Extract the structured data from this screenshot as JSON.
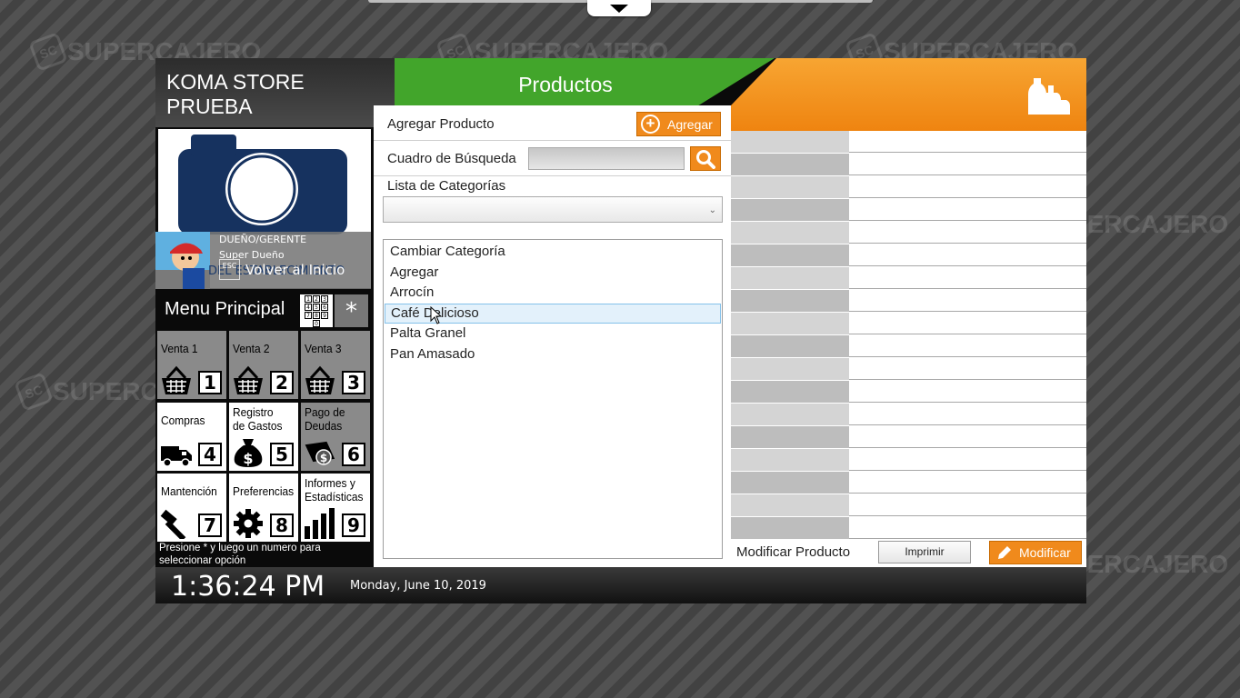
{
  "watermark": {
    "text": "SUPERCAJERO",
    "badge": "SC"
  },
  "store": {
    "line1": "KOMA STORE",
    "line2": "PRUEBA"
  },
  "user": {
    "role": "DUEÑO/GERENTE",
    "name": "Super Dueño",
    "establishment_text": "DEL ESTABLECIMIENTO",
    "esc_label": "ESC",
    "home_label": "Volver al Inicio"
  },
  "menu": {
    "title": "Menu Principal",
    "star_label": "*",
    "keypad_digits": [
      "1",
      "2",
      "3",
      "4",
      "5",
      "6",
      "7",
      "8",
      "9",
      "0"
    ],
    "tiles": [
      {
        "label": "Venta 1",
        "number": "1",
        "icon": "basket-icon"
      },
      {
        "label": "Venta 2",
        "number": "2",
        "icon": "basket-icon"
      },
      {
        "label": "Venta 3",
        "number": "3",
        "icon": "basket-icon"
      },
      {
        "label": "Compras",
        "number": "4",
        "icon": "truck-icon"
      },
      {
        "label": "Registro de Gastos",
        "line1": "Registro",
        "line2": "de Gastos",
        "number": "5",
        "icon": "money-bag-icon"
      },
      {
        "label": "Pago de Deudas",
        "line1": "Pago de",
        "line2": "Deudas",
        "number": "6",
        "icon": "bill-icon"
      },
      {
        "label": "Mantención",
        "number": "7",
        "icon": "hammer-icon"
      },
      {
        "label": "Preferencias",
        "number": "8",
        "icon": "gear-icon"
      },
      {
        "label": "Informes y Estadísticas",
        "line1": "Informes y",
        "line2": "Estadísticas",
        "number": "9",
        "icon": "bar-chart-icon"
      }
    ],
    "hint_line1": "Presione * y luego un numero para",
    "hint_line2": "seleccionar opción"
  },
  "footer": {
    "time": "1:36:24 PM",
    "date": "Monday, June 10, 2019"
  },
  "products": {
    "title": "Productos",
    "add_label": "Agregar Producto",
    "add_button": "Agregar",
    "search_label": "Cuadro de Búsqueda",
    "search_value": "",
    "category_label": "Lista de Categorías",
    "category_selected": "",
    "list": [
      "Cambiar Categoría",
      "Agregar",
      "Arrocín",
      "Café Delicioso",
      "Palta Granel",
      "Pan Amasado"
    ],
    "selected_item": "Café Delicioso"
  },
  "detail": {
    "modify_label": "Modificar Producto",
    "print_button": "Imprimir",
    "modify_button": "Modificar",
    "row_count": 18
  },
  "colors": {
    "green": "#42a52b",
    "orange": "#f08a1c",
    "navy": "#16325f"
  }
}
